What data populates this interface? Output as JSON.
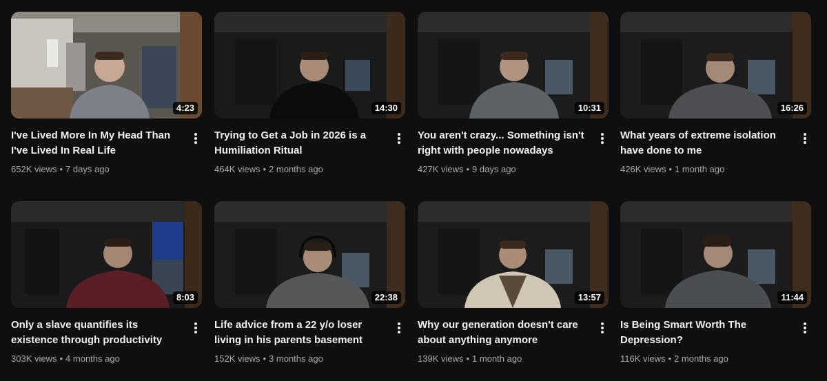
{
  "videos": [
    {
      "title": "I've Lived More In My Head Than I've Lived In Real Life",
      "views": "652K views",
      "age": "7 days ago",
      "duration": "4:23"
    },
    {
      "title": "Trying to Get a Job in 2026 is a Humiliation Ritual",
      "views": "464K views",
      "age": "2 months ago",
      "duration": "14:30"
    },
    {
      "title": "You aren't crazy... Something isn't right with people nowadays",
      "views": "427K views",
      "age": "9 days ago",
      "duration": "10:31"
    },
    {
      "title": "What years of extreme isolation have done to me",
      "views": "426K views",
      "age": "1 month ago",
      "duration": "16:26"
    },
    {
      "title": "Only a slave quantifies its existence through productivity",
      "views": "303K views",
      "age": "4 months ago",
      "duration": "8:03"
    },
    {
      "title": "Life advice from a 22 y/o loser living in his parents basement",
      "views": "152K views",
      "age": "3 months ago",
      "duration": "22:38"
    },
    {
      "title": "Why our generation doesn't care about anything anymore",
      "views": "139K views",
      "age": "1 month ago",
      "duration": "13:57"
    },
    {
      "title": "Is Being Smart Worth The Depression?",
      "views": "116K views",
      "age": "2 months ago",
      "duration": "11:44"
    }
  ],
  "separator": "•",
  "colors": {
    "background": "#0f0f0f",
    "title": "#f1f1f1",
    "meta": "#aaaaaa"
  },
  "icons": {
    "menu": "more-vert-icon"
  }
}
